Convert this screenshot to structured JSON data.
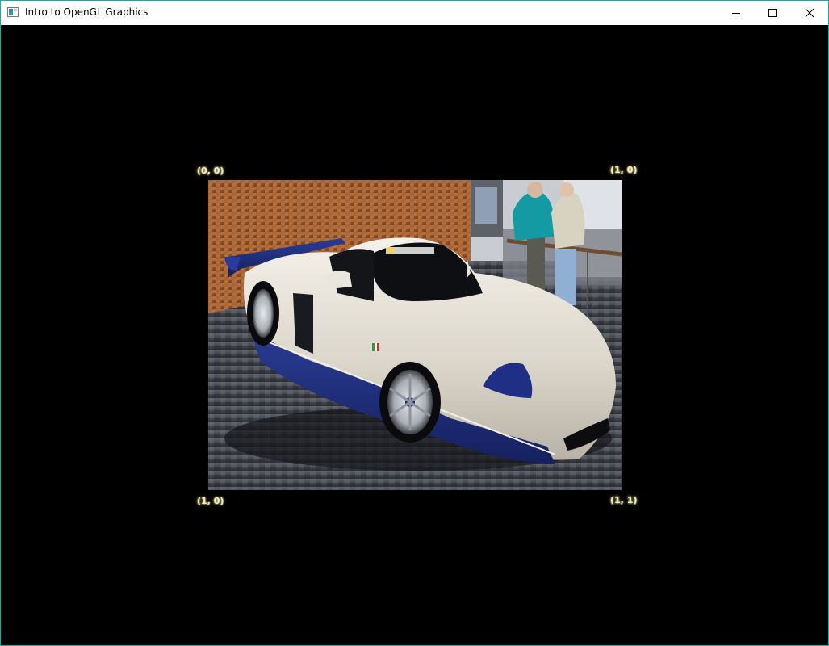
{
  "window": {
    "title": "Intro to OpenGL Graphics",
    "controls": {
      "minimize": "minimize",
      "maximize": "maximize",
      "close": "close"
    },
    "border_color": "#1aa9a0"
  },
  "viewport": {
    "background_color": "#000000",
    "texture_image": {
      "subject": "white and blue sports car on display",
      "icon": "texture-photo"
    },
    "corner_labels": {
      "top_left": "(0, 0)",
      "top_right": "(1, 0)",
      "bottom_left": "(1, 0)",
      "bottom_right": "(1, 1)"
    },
    "label_color": "#f3edc0"
  }
}
